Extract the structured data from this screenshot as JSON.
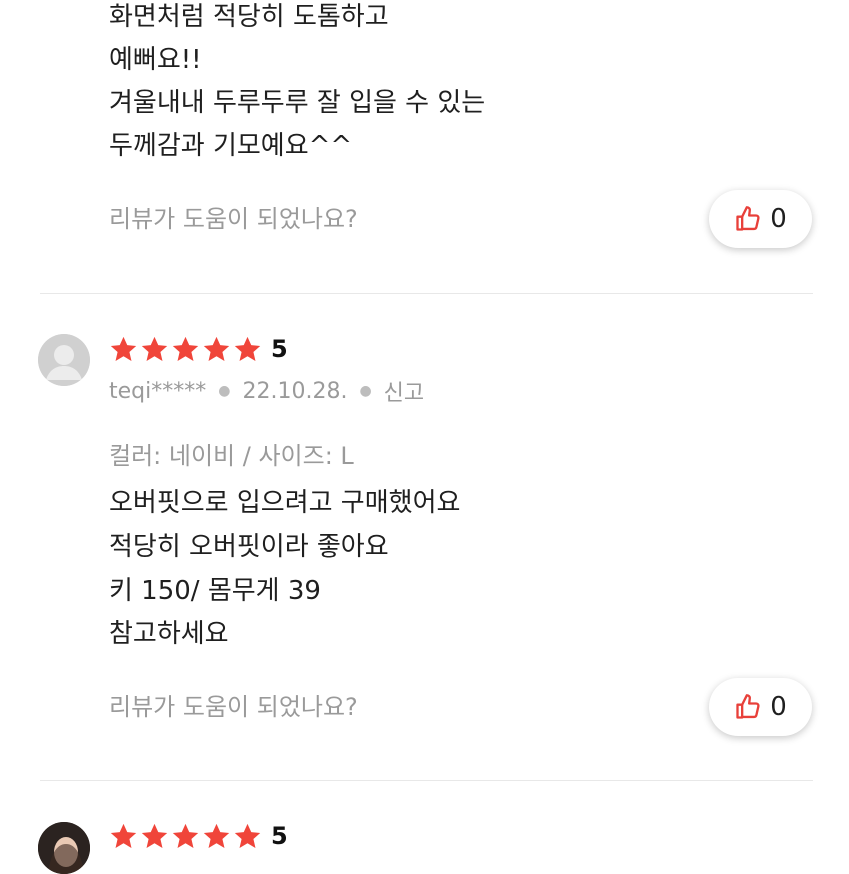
{
  "review_prev": {
    "body_lines": [
      "화면처럼 적당히 도톰하고",
      "예뻐요!!",
      "겨울내내 두루두루 잘 입을 수 있는",
      "두께감과 기모예요^^"
    ],
    "helpful_prompt": "리뷰가 도움이 되었나요?",
    "like_count": "0"
  },
  "review_1": {
    "rating": "5",
    "author": "teqi*****",
    "date": "22.10.28.",
    "report_label": "신고",
    "option": "컬러: 네이비 / 사이즈: L",
    "body_lines": [
      "오버핏으로 입으려고 구매했어요",
      "적당히 오버핏이라 좋아요",
      "키 150/ 몸무게 39",
      "참고하세요"
    ],
    "helpful_prompt": "리뷰가 도움이 되었나요?",
    "like_count": "0"
  },
  "review_2": {
    "rating": "5"
  },
  "colors": {
    "star": "#f0453a",
    "thumb": "#e8403a",
    "muted": "#9a9a9a"
  }
}
